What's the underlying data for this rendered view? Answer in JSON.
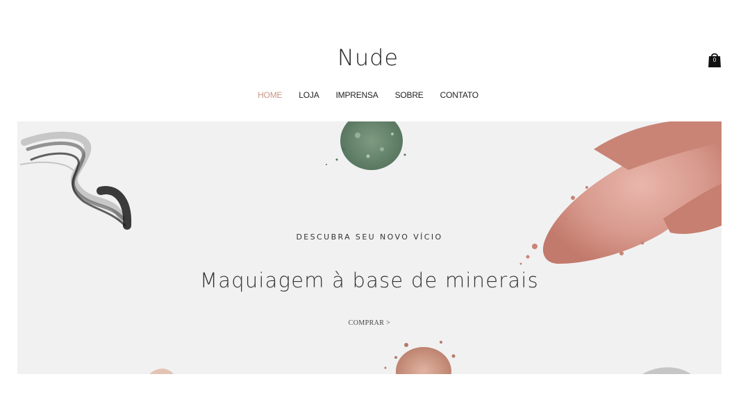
{
  "header": {
    "site_title": "Nude",
    "cart_count": "0",
    "cart_icon": "shopping-bag-icon"
  },
  "nav": {
    "items": [
      {
        "label": "HOME",
        "active": true
      },
      {
        "label": "LOJA",
        "active": false
      },
      {
        "label": "IMPRENSA",
        "active": false
      },
      {
        "label": "SOBRE",
        "active": false
      },
      {
        "label": "CONTATO",
        "active": false
      }
    ]
  },
  "hero": {
    "kicker": "DESCUBRA SEU NOVO VÍCIO",
    "headline": "Maquiagem à base de minerais",
    "cta": "COMPRAR >"
  },
  "colors": {
    "accent": "#c99785",
    "hero_background": "#f1f1f2",
    "text": "#222222",
    "blush": "#d49a8e",
    "green_powder": "#6b8a6d"
  }
}
